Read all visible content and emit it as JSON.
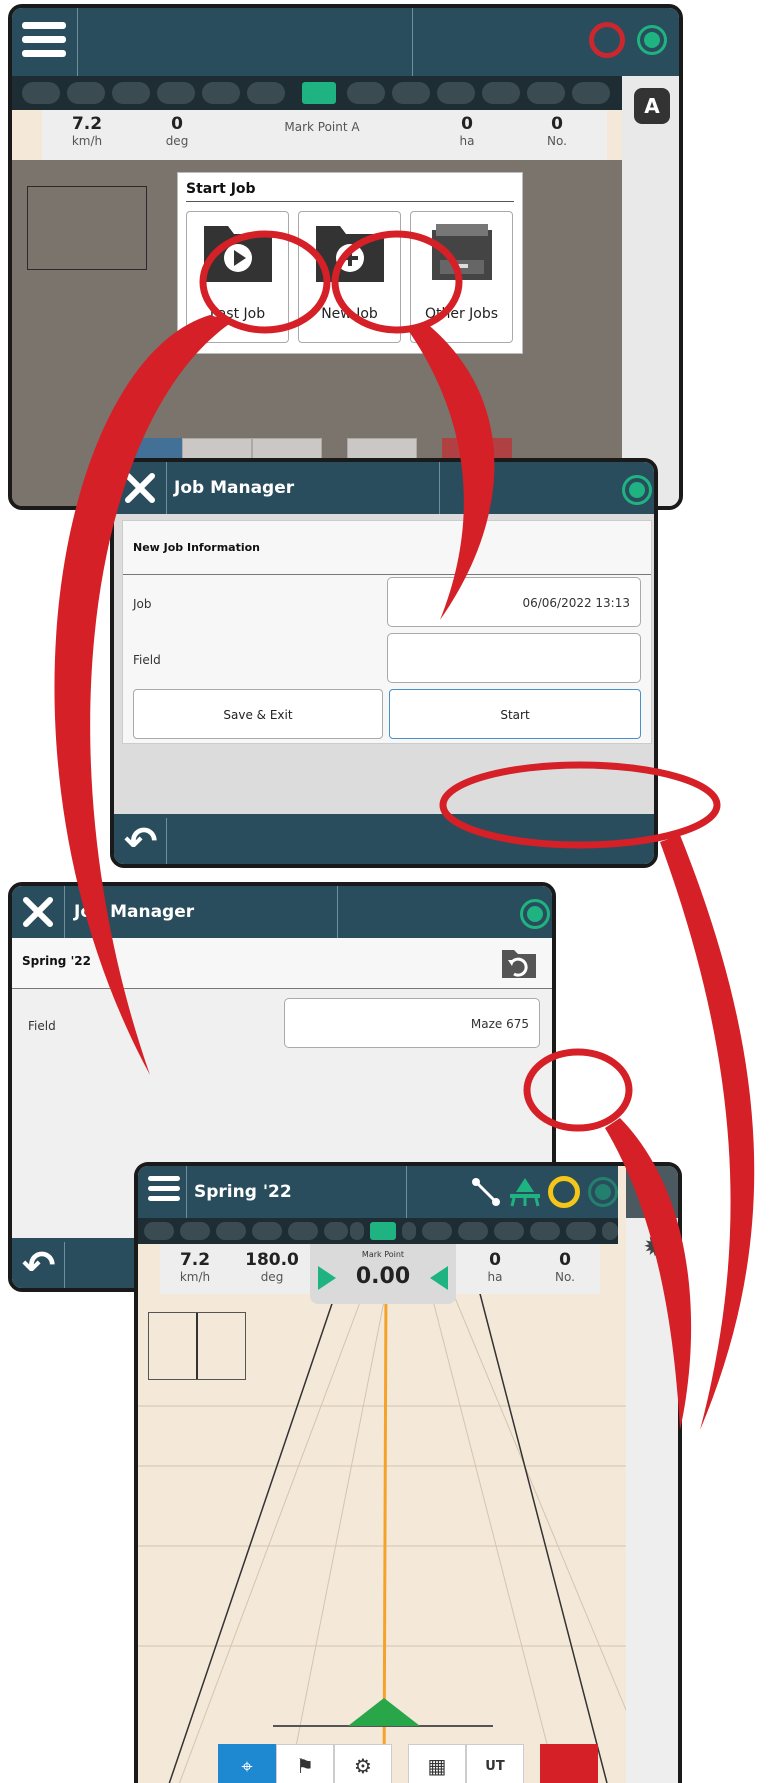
{
  "screen1": {
    "stats": [
      {
        "value": "7.2",
        "unit": "km/h"
      },
      {
        "value": "0",
        "unit": "deg"
      },
      {
        "value": "",
        "unit": "Mark Point A"
      },
      {
        "value": "0",
        "unit": "ha"
      },
      {
        "value": "0",
        "unit": "No."
      }
    ],
    "badge": "A",
    "dialog": {
      "title": "Start Job",
      "buttons": [
        "Last Job",
        "New Job",
        "Other Jobs"
      ]
    }
  },
  "screen2": {
    "title": "Job Manager",
    "section": "New Job Information",
    "rows": [
      {
        "label": "Job",
        "value": "06/06/2022 13:13"
      },
      {
        "label": "Field",
        "value": ""
      }
    ],
    "save_exit": "Save & Exit",
    "start": "Start"
  },
  "screen3": {
    "title": "Job Manager",
    "job_name": "Spring '22",
    "field_label": "Field",
    "field_value": "Maze 675"
  },
  "screen4": {
    "title": "Spring '22",
    "stats": [
      {
        "value": "7.2",
        "unit": "km/h"
      },
      {
        "value": "180.0",
        "unit": "deg"
      },
      {
        "value": "0",
        "unit": "ha"
      },
      {
        "value": "0",
        "unit": "No."
      }
    ],
    "mark_label": "Mark Point",
    "mark_value": "0.00"
  },
  "colors": {
    "accent_green": "#1fb381",
    "bar_blue": "#294d5c",
    "callout_red": "#d52027"
  }
}
